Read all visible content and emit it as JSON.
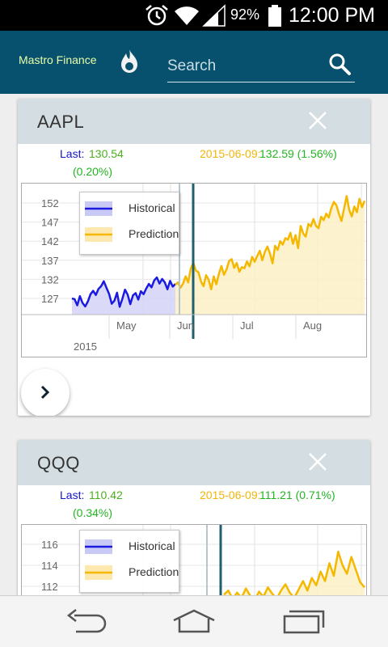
{
  "status_bar": {
    "battery_percent": "92%",
    "time": "12:00 PM",
    "icons": [
      "alarm-icon",
      "wifi-icon",
      "signal-icon",
      "battery-icon"
    ]
  },
  "app": {
    "title": "Mastro Finance",
    "logo_icon": "flame-logo-icon",
    "header_color": "#07506e"
  },
  "search": {
    "placeholder": "Search",
    "icon": "search-icon"
  },
  "colors": {
    "historical": "#1a1ae0",
    "prediction": "#f5b800",
    "marker": "#1f5f6e"
  },
  "cards": [
    {
      "symbol": "AAPL",
      "last_label": "Last:",
      "last_value": "130.54",
      "last_change": "(0.20%)",
      "prediction_date": "2015-06-09:",
      "prediction_value": "132.59 (1.56%)",
      "legend": {
        "historical": "Historical",
        "prediction": "Prediction"
      },
      "chart_data": {
        "type": "line",
        "y_ticks": [
          "152",
          "147",
          "142",
          "137",
          "132",
          "127"
        ],
        "x_ticks": [
          "May",
          "Jun",
          "Jul",
          "Aug"
        ],
        "year_label": "2015",
        "series": [
          {
            "name": "Historical",
            "values": [
              127.0,
              126.8,
              125.2,
              127.6,
              125.8,
              124.9,
              126.2,
              128.1,
              129.0,
              127.9,
              129.5,
              130.2,
              131.5,
              129.8,
              128.2,
              125.6,
              126.4,
              128.5,
              124.8,
              126.9,
              129.3,
              128.0,
              125.5,
              127.8,
              128.4,
              126.7,
              128.9,
              128.1,
              129.6,
              130.8,
              129.9,
              131.7,
              132.5,
              130.9,
              132.1,
              131.2,
              129.4,
              131.6,
              130.1,
              130.8
            ]
          },
          {
            "name": "Prediction",
            "values": [
              130.6,
              131.2,
              129.8,
              130.9,
              132.8,
              131.2,
              134.8,
              136.4,
              134.3,
              133.9,
              131.5,
              130.2,
              133.1,
              131.9,
              129.4,
              132.8,
              130.7,
              133.4,
              135.5,
              133.2,
              134.6,
              136.8,
              137.3,
              135.0,
              136.3,
              134.0,
              135.2,
              134.9,
              136.7,
              135.4,
              137.9,
              136.6,
              138.1,
              139.5,
              137.0,
              139.2,
              140.6,
              138.8,
              136.2,
              140.8,
              139.7,
              142.0,
              141.1,
              142.8,
              142.4,
              144.2,
              141.3,
              143.6,
              140.2,
              146.0,
              144.0,
              143.2,
              146.5,
              145.9,
              147.8,
              146.0,
              145.4,
              148.4,
              147.5,
              149.2,
              148.2,
              150.7,
              152.3,
              151.4,
              149.1,
              147.3,
              150.6,
              153.8,
              150.2,
              148.5,
              151.1,
              149.6,
              153.1,
              150.9,
              152.6
            ]
          }
        ]
      }
    },
    {
      "symbol": "QQQ",
      "last_label": "Last:",
      "last_value": "110.42",
      "last_change": "(0.34%)",
      "prediction_date": "2015-06-09:",
      "prediction_value": "111.21 (0.71%)",
      "legend": {
        "historical": "Historical",
        "prediction": "Prediction"
      },
      "chart_data": {
        "type": "line",
        "y_ticks": [
          "116",
          "114",
          "112"
        ],
        "series": [
          {
            "name": "Prediction",
            "values": [
              111.2,
              111.6,
              110.8,
              111.4,
              110.9,
              111.8,
              111.1,
              110.7,
              111.5,
              111.0,
              111.9,
              111.3,
              110.8,
              111.6,
              112.2,
              111.4,
              110.9,
              111.7,
              112.5,
              111.6,
              112.8,
              112.1,
              113.4,
              112.5,
              114.2,
              113.0,
              115.3,
              114.0,
              113.2,
              114.8,
              113.6,
              112.4,
              111.9
            ]
          }
        ]
      }
    }
  ]
}
